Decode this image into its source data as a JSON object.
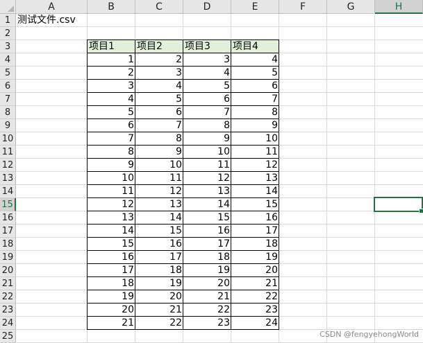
{
  "columns": [
    "A",
    "B",
    "C",
    "D",
    "E",
    "F",
    "G",
    "H"
  ],
  "active_column": "H",
  "rows": [
    "1",
    "2",
    "3",
    "4",
    "5",
    "6",
    "7",
    "8",
    "9",
    "10",
    "11",
    "12",
    "13",
    "14",
    "15",
    "16",
    "17",
    "18",
    "19",
    "20",
    "21",
    "22",
    "23",
    "24",
    "25"
  ],
  "active_row": "15",
  "a1_text": "测试文件.csv",
  "table": {
    "headers": [
      "项目1",
      "项目2",
      "项目3",
      "项目4"
    ],
    "rows": [
      [
        "1",
        "2",
        "3",
        "4"
      ],
      [
        "2",
        "3",
        "4",
        "5"
      ],
      [
        "3",
        "4",
        "5",
        "6"
      ],
      [
        "4",
        "5",
        "6",
        "7"
      ],
      [
        "5",
        "6",
        "7",
        "8"
      ],
      [
        "6",
        "7",
        "8",
        "9"
      ],
      [
        "7",
        "8",
        "9",
        "10"
      ],
      [
        "8",
        "9",
        "10",
        "11"
      ],
      [
        "9",
        "10",
        "11",
        "12"
      ],
      [
        "10",
        "11",
        "12",
        "13"
      ],
      [
        "11",
        "12",
        "13",
        "14"
      ],
      [
        "12",
        "13",
        "14",
        "15"
      ],
      [
        "13",
        "14",
        "15",
        "16"
      ],
      [
        "14",
        "15",
        "16",
        "17"
      ],
      [
        "15",
        "16",
        "17",
        "18"
      ],
      [
        "16",
        "17",
        "18",
        "19"
      ],
      [
        "17",
        "18",
        "19",
        "20"
      ],
      [
        "18",
        "19",
        "20",
        "21"
      ],
      [
        "19",
        "20",
        "21",
        "22"
      ],
      [
        "20",
        "21",
        "22",
        "23"
      ],
      [
        "21",
        "22",
        "23",
        "24"
      ]
    ]
  },
  "watermark": "CSDN @fengyehongWorld",
  "colors": {
    "header_bg": "#e6e6e6",
    "active_accent": "#217346",
    "table_header_fill": "#e2efda",
    "gridline": "#d9d9d9"
  }
}
